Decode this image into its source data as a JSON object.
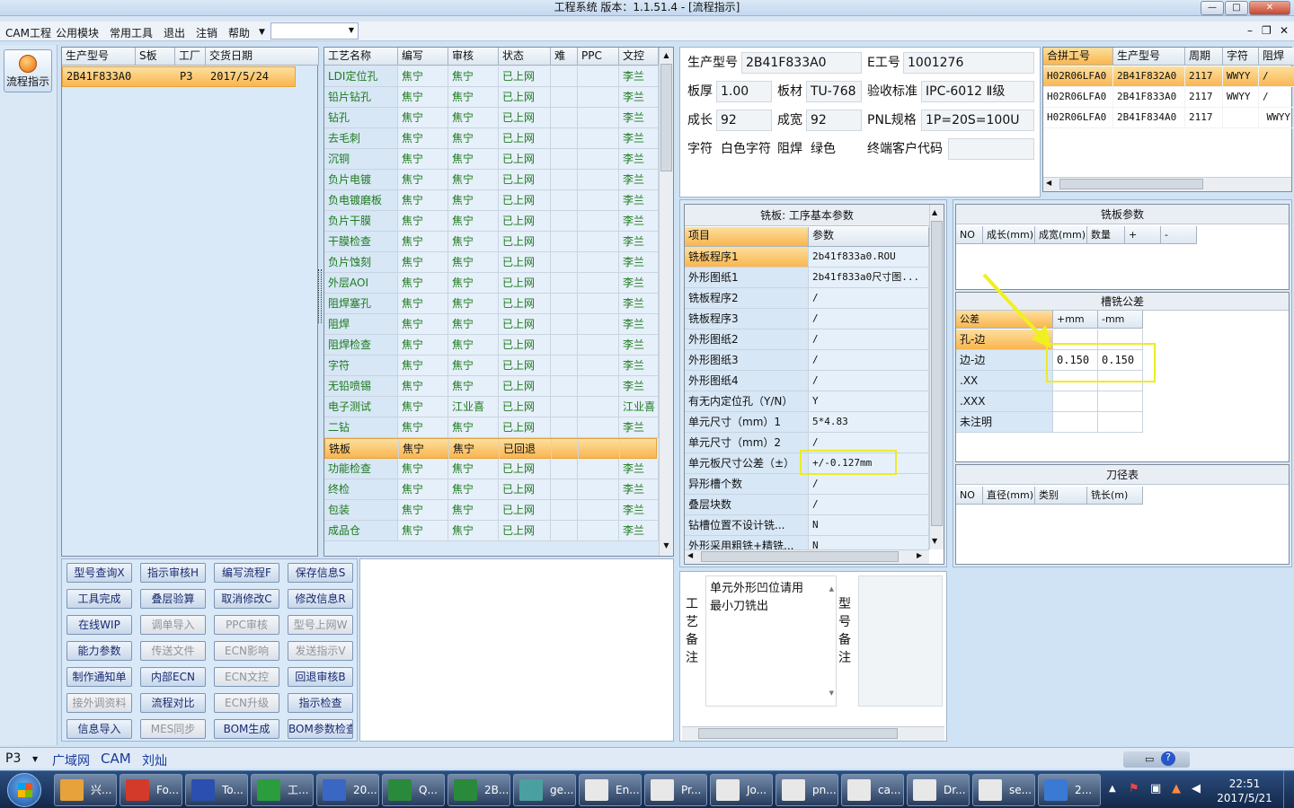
{
  "window": {
    "title": "工程系统   版本：1.1.51.4 - [流程指示]"
  },
  "menu": {
    "items": [
      "CAM工程",
      "公用模块",
      "常用工具",
      "退出",
      "注销",
      "帮助"
    ]
  },
  "left_nav": {
    "flow_button": "流程指示"
  },
  "orders": {
    "headers": [
      "生产型号",
      "S板",
      "工厂",
      "交货日期"
    ],
    "row": {
      "model": "2B41F833A0",
      "s": "",
      "factory": "P3",
      "date": "2017/5/24"
    }
  },
  "process": {
    "headers": [
      "工艺名称",
      "编写",
      "审核",
      "状态",
      "难",
      "PPC",
      "文控"
    ],
    "rows": [
      [
        "LDI定位孔",
        "焦宁",
        "焦宁",
        "已上网",
        "",
        "",
        "李兰"
      ],
      [
        "铅片钻孔",
        "焦宁",
        "焦宁",
        "已上网",
        "",
        "",
        "李兰"
      ],
      [
        "钻孔",
        "焦宁",
        "焦宁",
        "已上网",
        "",
        "",
        "李兰"
      ],
      [
        "去毛刺",
        "焦宁",
        "焦宁",
        "已上网",
        "",
        "",
        "李兰"
      ],
      [
        "沉铜",
        "焦宁",
        "焦宁",
        "已上网",
        "",
        "",
        "李兰"
      ],
      [
        "负片电镀",
        "焦宁",
        "焦宁",
        "已上网",
        "",
        "",
        "李兰"
      ],
      [
        "负电镀磨板",
        "焦宁",
        "焦宁",
        "已上网",
        "",
        "",
        "李兰"
      ],
      [
        "负片干膜",
        "焦宁",
        "焦宁",
        "已上网",
        "",
        "",
        "李兰"
      ],
      [
        "干膜检查",
        "焦宁",
        "焦宁",
        "已上网",
        "",
        "",
        "李兰"
      ],
      [
        "负片蚀刻",
        "焦宁",
        "焦宁",
        "已上网",
        "",
        "",
        "李兰"
      ],
      [
        "外层AOI",
        "焦宁",
        "焦宁",
        "已上网",
        "",
        "",
        "李兰"
      ],
      [
        "阻焊塞孔",
        "焦宁",
        "焦宁",
        "已上网",
        "",
        "",
        "李兰"
      ],
      [
        "阻焊",
        "焦宁",
        "焦宁",
        "已上网",
        "",
        "",
        "李兰"
      ],
      [
        "阻焊检查",
        "焦宁",
        "焦宁",
        "已上网",
        "",
        "",
        "李兰"
      ],
      [
        "字符",
        "焦宁",
        "焦宁",
        "已上网",
        "",
        "",
        "李兰"
      ],
      [
        "无铅喷锡",
        "焦宁",
        "焦宁",
        "已上网",
        "",
        "",
        "李兰"
      ],
      [
        "电子测试",
        "焦宁",
        "江业喜",
        "已上网",
        "",
        "",
        "江业喜"
      ],
      [
        "二钻",
        "焦宁",
        "焦宁",
        "已上网",
        "",
        "",
        "李兰"
      ],
      [
        "铣板",
        "焦宁",
        "焦宁",
        "已回退",
        "",
        "",
        ""
      ],
      [
        "功能检查",
        "焦宁",
        "焦宁",
        "已上网",
        "",
        "",
        "李兰"
      ],
      [
        "终检",
        "焦宁",
        "焦宁",
        "已上网",
        "",
        "",
        "李兰"
      ],
      [
        "包装",
        "焦宁",
        "焦宁",
        "已上网",
        "",
        "",
        "李兰"
      ],
      [
        "成品仓",
        "焦宁",
        "焦宁",
        "已上网",
        "",
        "",
        "李兰"
      ]
    ]
  },
  "buttons": [
    [
      "型号查询X",
      "指示审核H",
      "编写流程F",
      "保存信息S"
    ],
    [
      "工具完成",
      "叠层验算",
      "取消修改C",
      "修改信息R"
    ],
    [
      "在线WIP",
      "调单导入",
      "PPC审核",
      "型号上网W"
    ],
    [
      "能力参数",
      "传送文件",
      "ECN影响",
      "发送指示V"
    ],
    [
      "制作通知单",
      "内部ECN",
      "ECN文控",
      "回退审核B"
    ],
    [
      "接外调资料",
      "流程对比",
      "ECN升级",
      "指示检查"
    ],
    [
      "信息导入",
      "MES同步",
      "BOM生成",
      "BOM参数检查"
    ]
  ],
  "buttons_disabled": [
    [
      false,
      false,
      false,
      false
    ],
    [
      false,
      false,
      false,
      false
    ],
    [
      false,
      true,
      true,
      true
    ],
    [
      false,
      true,
      true,
      true
    ],
    [
      false,
      false,
      true,
      false
    ],
    [
      true,
      false,
      true,
      false
    ],
    [
      false,
      true,
      false,
      false
    ]
  ],
  "info": {
    "model_label": "生产型号",
    "model": "2B41F833A0",
    "eno_label": "E工号",
    "eno": "1001276",
    "thick_label": "板厚",
    "thick": "1.00",
    "material_label": "板材",
    "material": "TU-768",
    "std_label": "验收标准",
    "std": "IPC-6012 Ⅱ级",
    "len_label": "成长",
    "len": "92",
    "width_label": "成宽",
    "width": "92",
    "pnl_label": "PNL规格",
    "pnl": "1P=20S=100U",
    "char_label": "字符",
    "char": "白色字符",
    "mask_label": "阻焊",
    "mask": "绿色",
    "cust_label": "终端客户代码",
    "cust": ""
  },
  "combine": {
    "headers": [
      "合拼工号",
      "生产型号",
      "周期",
      "字符",
      "阻焊"
    ],
    "rows": [
      [
        "H02R06LFA0",
        "2B41F832A0",
        "2117",
        "WWYY",
        "/"
      ],
      [
        "H02R06LFA0",
        "2B41F833A0",
        "2117",
        "WWYY",
        "/"
      ],
      [
        "H02R06LFA0",
        "2B41F834A0",
        "2117",
        "",
        "WWYY"
      ]
    ]
  },
  "milling": {
    "title": "铣板: 工序基本参数",
    "headers": [
      "项目",
      "参数"
    ],
    "rows": [
      [
        "铣板程序1",
        "2b41f833a0.ROU"
      ],
      [
        "外形图纸1",
        "2b41f833a0尺寸图..."
      ],
      [
        "铣板程序2",
        "/"
      ],
      [
        "铣板程序3",
        "/"
      ],
      [
        "外形图纸2",
        "/"
      ],
      [
        "外形图纸3",
        "/"
      ],
      [
        "外形图纸4",
        "/"
      ],
      [
        "有无内定位孔（Y/N）",
        "Y"
      ],
      [
        "单元尺寸（mm）1",
        "5*4.83"
      ],
      [
        "单元尺寸（mm）2",
        "/"
      ],
      [
        "单元板尺寸公差（±）",
        "+/-0.127mm"
      ],
      [
        "异形槽个数",
        "/"
      ],
      [
        "叠层块数",
        "/"
      ],
      [
        "钻槽位置不设计铣...",
        "N"
      ],
      [
        "外形采用粗铣+精铣...",
        "N"
      ]
    ]
  },
  "mill_params": {
    "title": "铣板参数",
    "headers": [
      "NO",
      "成长(mm)",
      "成宽(mm)",
      "数量",
      "+",
      "-"
    ]
  },
  "tolerance": {
    "title": "槽铣公差",
    "headers": [
      "公差",
      "+mm",
      "-mm"
    ],
    "rows": [
      [
        "孔-边",
        "",
        ""
      ],
      [
        "边-边",
        "0.150",
        "0.150"
      ],
      [
        ".XX",
        "",
        ""
      ],
      [
        ".XXX",
        "",
        ""
      ],
      [
        "未注明",
        "",
        ""
      ]
    ]
  },
  "tools": {
    "title": "刀径表",
    "headers": [
      "NO",
      "直径(mm)",
      "类别",
      "铣长(m)"
    ]
  },
  "remarks": {
    "process_label": "工艺备注",
    "process_text_1": "单元外形凹位请用",
    "process_text_2": "最小刀铣出",
    "model_label": "型号备注"
  },
  "status": {
    "factory": "P3",
    "items": [
      "广域网",
      "CAM",
      "刘灿"
    ]
  },
  "taskbar": {
    "items": [
      "兴...",
      "Fo...",
      "To...",
      "工...",
      "20...",
      "Q...",
      "2B...",
      "ge...",
      "En...",
      "Pr...",
      "Jo...",
      "pn...",
      "ca...",
      "Dr...",
      "se...",
      "2..."
    ],
    "time": "22:51",
    "date": "2017/5/21"
  }
}
